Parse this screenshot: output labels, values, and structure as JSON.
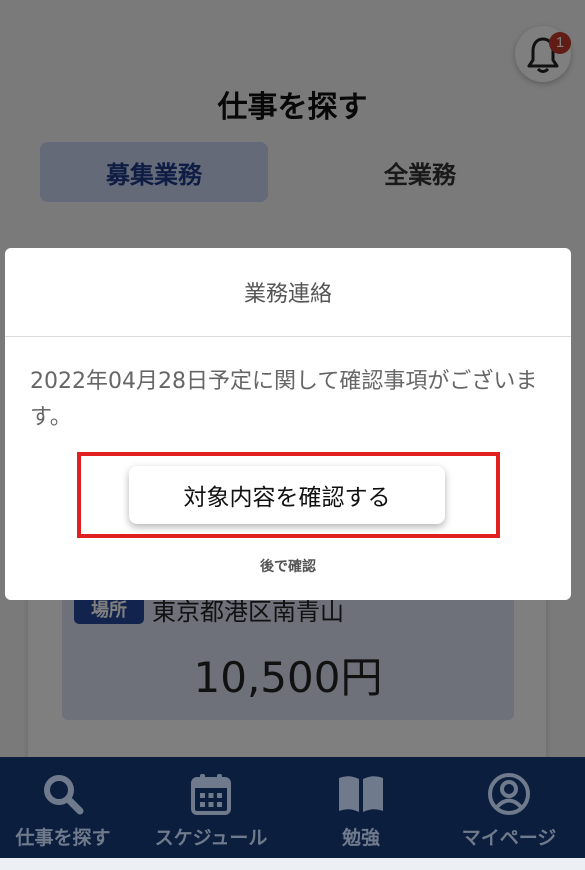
{
  "notification": {
    "badge_count": "1"
  },
  "header": {
    "title": "仕事を探す"
  },
  "tabs": [
    {
      "label": "募集業務",
      "active": true
    },
    {
      "label": "全業務",
      "active": false
    }
  ],
  "job_card": {
    "location_badge": "場所",
    "location": "東京都港区南青山",
    "price": "10,500円"
  },
  "modal": {
    "title": "業務連絡",
    "message": "2022年04月28日予定に関して確認事項がございます。",
    "confirm_button": "対象内容を確認する",
    "later_link": "後で確認"
  },
  "bottom_nav": [
    {
      "label": "仕事を探す",
      "icon": "search-icon"
    },
    {
      "label": "スケジュール",
      "icon": "calendar-icon"
    },
    {
      "label": "勉強",
      "icon": "book-icon"
    },
    {
      "label": "マイページ",
      "icon": "user-icon"
    }
  ],
  "colors": {
    "nav_background": "#0c1e3d",
    "highlight_border": "#e02020",
    "tab_active_bg": "#c9d4f0",
    "badge": "#c0392b"
  }
}
